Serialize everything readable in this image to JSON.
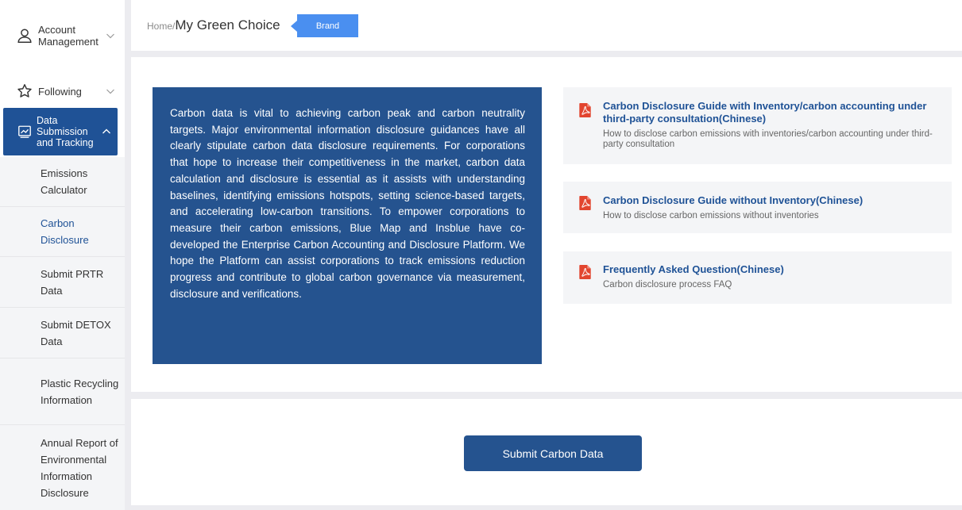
{
  "sidebar": {
    "account": {
      "label": "Account Management",
      "icon": "user-icon"
    },
    "following": {
      "label": "Following",
      "icon": "star-icon"
    },
    "data_group": {
      "label": "Data Submission and Tracking",
      "icon": "chart-icon"
    },
    "subitems": [
      {
        "label": "Emissions Calculator",
        "active": false
      },
      {
        "label": "Carbon Disclosure",
        "active": true
      },
      {
        "label": "Submit PRTR Data",
        "active": false
      },
      {
        "label": "Submit DETOX Data",
        "active": false
      },
      {
        "label": "Plastic Recycling Information",
        "active": false
      },
      {
        "label": "Annual Report of Environmental Information Disclosure",
        "active": false
      }
    ]
  },
  "header": {
    "home": "Home",
    "sep": "/",
    "title": "My Green Choice",
    "tag": "Brand"
  },
  "intro": {
    "text": "Carbon data is vital to achieving carbon peak and carbon neutrality targets. Major environmental information disclosure guidances have all clearly stipulate carbon data disclosure requirements. For corporations that hope to increase their competitiveness in the market, carbon data calculation and disclosure is essential as it assists with understanding baselines, identifying emissions hotspots, setting science-based targets, and accelerating low-carbon transitions. To empower corporations to measure their carbon emissions, Blue Map and Insblue have co-developed the Enterprise Carbon Accounting and Disclosure Platform. We hope the Platform can assist corporations to track emissions reduction progress and contribute to global carbon governance via measurement, disclosure and verifications."
  },
  "docs": [
    {
      "title": "Carbon Disclosure Guide with Inventory/carbon accounting under third-party consultation(Chinese)",
      "desc": "How to disclose carbon emissions with inventories/carbon accounting under third-party consultation",
      "icon": "pdf-icon"
    },
    {
      "title": "Carbon Disclosure Guide without Inventory(Chinese)",
      "desc": "How to disclose carbon emissions without inventories",
      "icon": "pdf-icon"
    },
    {
      "title": "Frequently Asked Question(Chinese)",
      "desc": "Carbon disclosure process FAQ",
      "icon": "pdf-icon"
    }
  ],
  "actions": {
    "submit": "Submit Carbon Data"
  },
  "colors": {
    "primary": "#25538f",
    "tag": "#4a8ff0",
    "pdf": "#e2452f"
  }
}
